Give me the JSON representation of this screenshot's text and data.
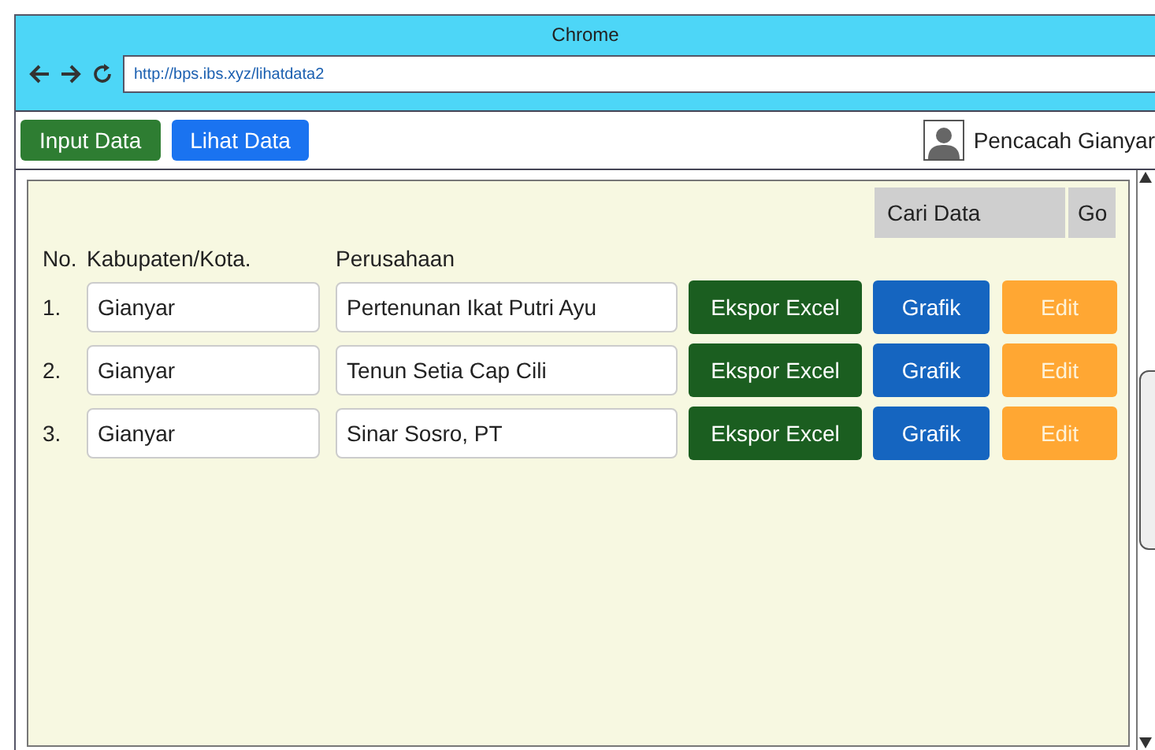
{
  "window": {
    "title": "Chrome",
    "url": "http://bps.ibs.xyz/lihatdata2"
  },
  "nav": {
    "tabs": [
      {
        "label": "Input Data",
        "selected": false
      },
      {
        "label": "Lihat Data",
        "selected": true
      }
    ],
    "user": "Pencacah Gianyar"
  },
  "search": {
    "placeholder": "Cari Data",
    "button": "Go"
  },
  "table": {
    "columns": [
      "No.",
      "Kabupaten/Kota.",
      "Perusahaan"
    ],
    "rows": [
      {
        "no": "1.",
        "kabupaten": "Gianyar",
        "perusahaan": "Pertenunan Ikat Putri Ayu",
        "actions": [
          "Ekspor Excel",
          "Grafik",
          "Edit"
        ]
      },
      {
        "no": "2.",
        "kabupaten": "Gianyar",
        "perusahaan": "Tenun Setia Cap Cili",
        "actions": [
          "Ekspor Excel",
          "Grafik",
          "Edit"
        ]
      },
      {
        "no": "3.",
        "kabupaten": "Gianyar",
        "perusahaan": "Sinar Sosro, PT",
        "actions": [
          "Ekspor Excel",
          "Grafik",
          "Edit"
        ]
      }
    ]
  }
}
